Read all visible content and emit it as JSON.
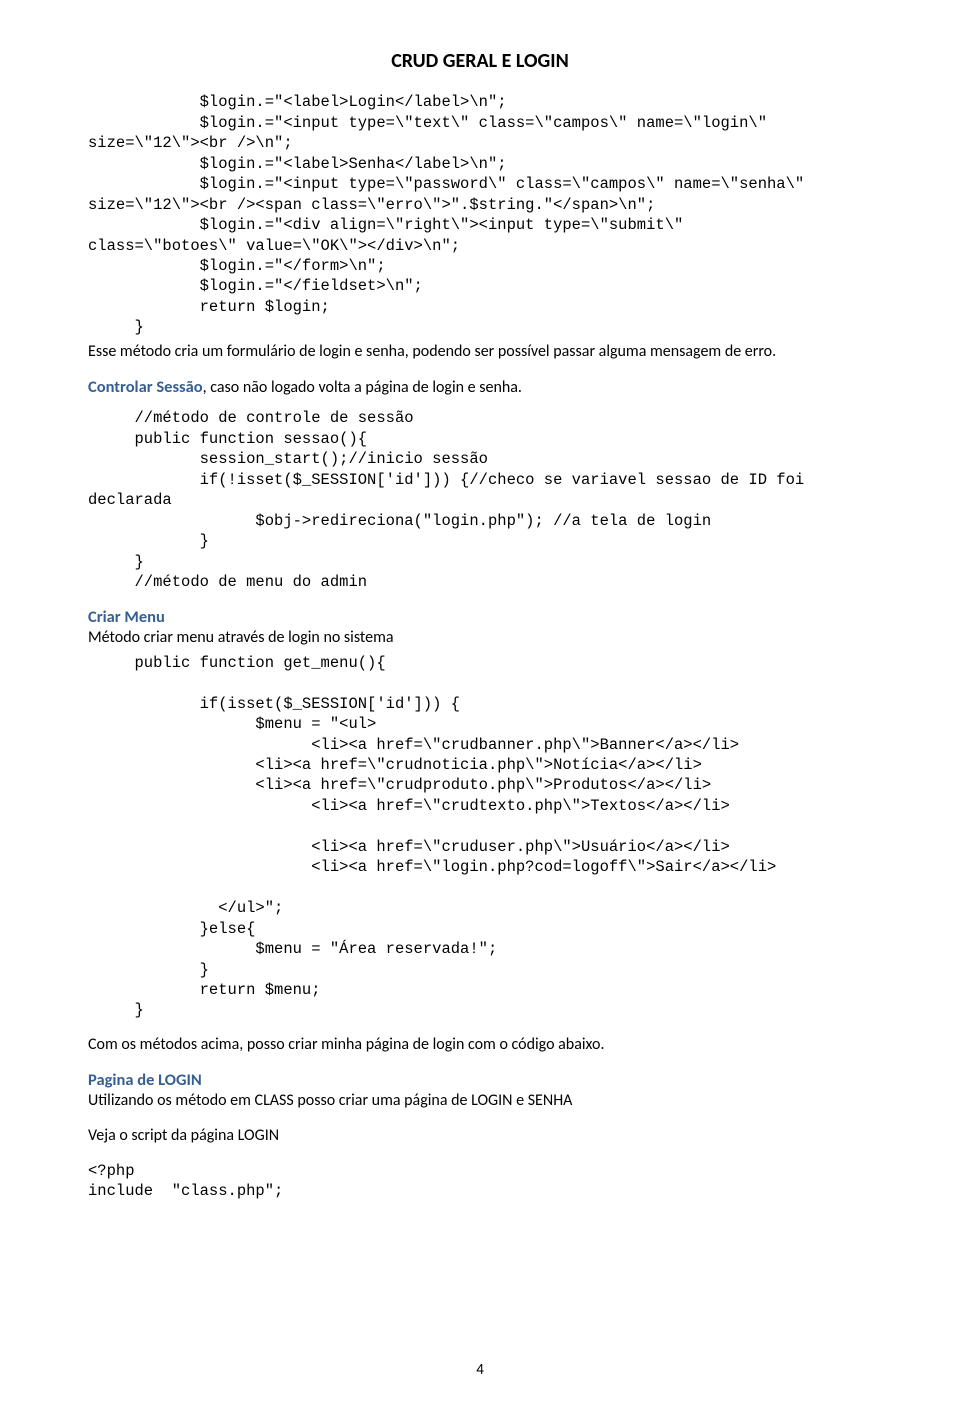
{
  "title": "CRUD GERAL E LOGIN",
  "block1": {
    "l1": "            $login.=\"<label>Login</label>\\n\";",
    "l2": "            $login.=\"<input type=\\\"text\\\" class=\\\"campos\\\" name=\\\"login\\\"",
    "l3": "size=\\\"12\\\"><br />\\n\";",
    "l4": "            $login.=\"<label>Senha</label>\\n\";",
    "l5": "            $login.=\"<input type=\\\"password\\\" class=\\\"campos\\\" name=\\\"senha\\\"",
    "l6": "size=\\\"12\\\"><br /><span class=\\\"erro\\\">\".$string.\"</span>\\n\";",
    "l7": "            $login.=\"<div align=\\\"right\\\"><input type=\\\"submit\\\"",
    "l8": "class=\\\"botoes\\\" value=\\\"OK\\\"></div>\\n\";",
    "l9": "            $login.=\"</form>\\n\";",
    "l10": "            $login.=\"</fieldset>\\n\";",
    "l11": "            return $login;",
    "l12": "     }"
  },
  "narr1": "Esse método cria um formulário de login e senha, podendo ser possível passar alguma mensagem de erro.",
  "ctrl_label": "Controlar Sessão",
  "ctrl_rest": ", caso não logado volta a página de login e senha.",
  "block2": {
    "l1": "     //método de controle de sessão",
    "l2": "     public function sessao(){",
    "l3": "            session_start();//inicio sessão",
    "l4": "            if(!isset($_SESSION['id'])) {//checo se variavel sessao de ID foi",
    "l5": "declarada",
    "l6": "                  $obj->redireciona(\"login.php\"); //a tela de login",
    "l7": "            }",
    "l8": "     }",
    "l9": "     //método de menu do admin"
  },
  "menu_label": "Criar Menu",
  "menu_desc": "Método criar menu através de login no sistema",
  "block3": {
    "l1": "     public function get_menu(){",
    "l2": "",
    "l3": "            if(isset($_SESSION['id'])) {",
    "l4": "                  $menu = \"<ul>",
    "l5": "                        <li><a href=\\\"crudbanner.php\\\">Banner</a></li>",
    "l6": "                  <li><a href=\\\"crudnoticia.php\\\">Notícia</a></li>",
    "l7": "                  <li><a href=\\\"crudproduto.php\\\">Produtos</a></li>",
    "l8": "                        <li><a href=\\\"crudtexto.php\\\">Textos</a></li>",
    "l9": "",
    "l10": "                        <li><a href=\\\"cruduser.php\\\">Usuário</a></li>",
    "l11": "                        <li><a href=\\\"login.php?cod=logoff\\\">Sair</a></li>",
    "l12": "",
    "l13": "              </ul>\";",
    "l14": "            }else{",
    "l15": "                  $menu = \"Área reservada!\";",
    "l16": "            }",
    "l17": "            return $menu;",
    "l18": "     }"
  },
  "narr2": "Com os métodos acima, posso criar minha página de login com o código abaixo.",
  "pg_label": "Pagina de LOGIN",
  "pg_desc": "Utilizando os método em CLASS posso criar uma página de LOGIN e SENHA",
  "pg_script": "Veja o script da página LOGIN",
  "block4": {
    "l1": "<?php",
    "l2": "include  \"class.php\";"
  },
  "page_number": "4"
}
